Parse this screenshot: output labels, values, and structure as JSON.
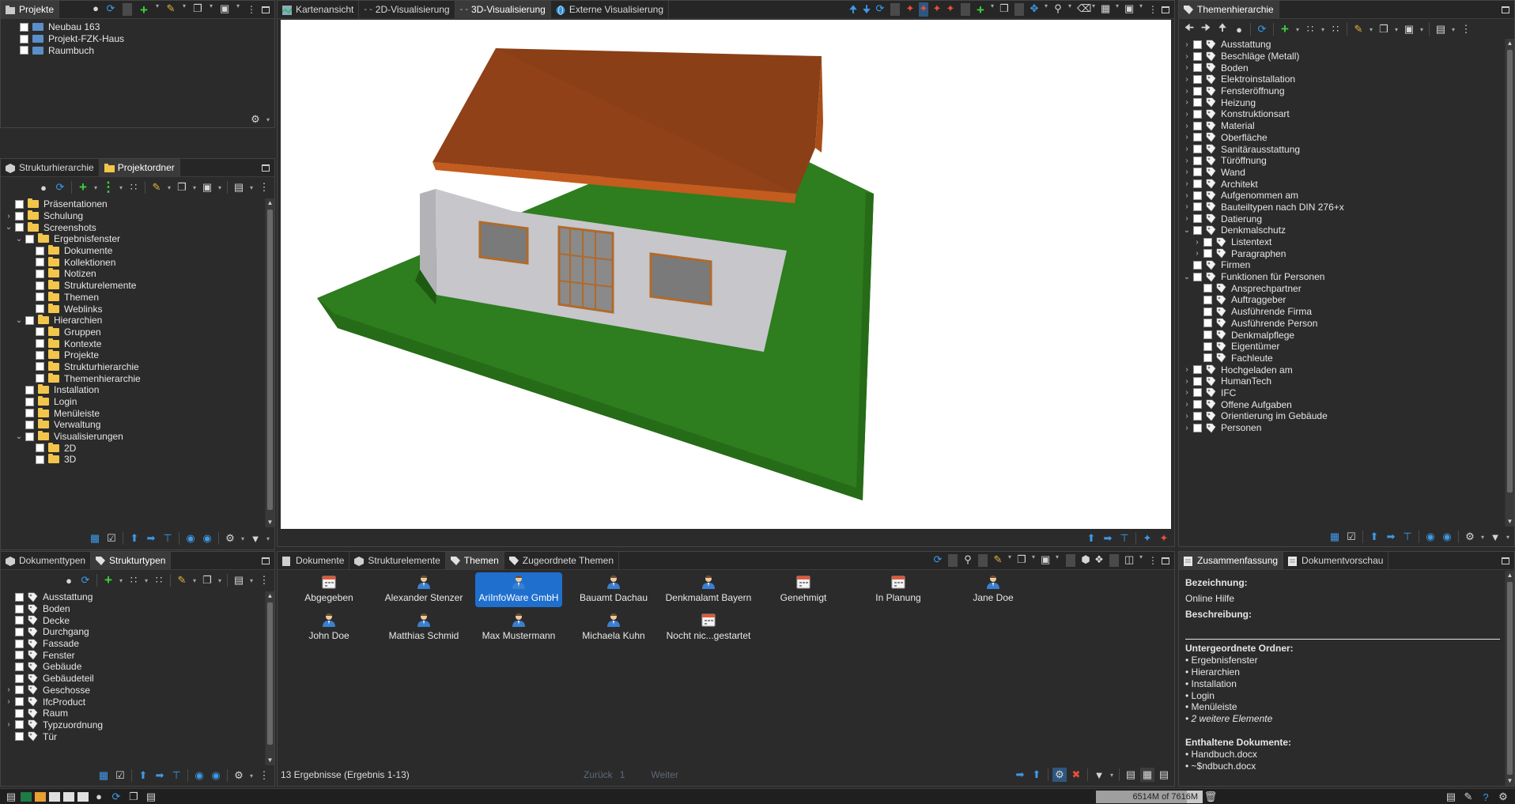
{
  "projects_panel": {
    "tab": "Projekte",
    "items": [
      "Neubau 163",
      "Projekt-FZK-Haus",
      "Raumbuch"
    ]
  },
  "folder_panel": {
    "tabs": [
      "Strukturhierarchie",
      "Projektordner"
    ],
    "items": [
      {
        "label": "Präsentationen",
        "level": 0,
        "twisty": ""
      },
      {
        "label": "Schulung",
        "level": 0,
        "twisty": ">"
      },
      {
        "label": "Screenshots",
        "level": 0,
        "twisty": "v"
      },
      {
        "label": "Ergebnisfenster",
        "level": 1,
        "twisty": "v"
      },
      {
        "label": "Dokumente",
        "level": 2,
        "twisty": ""
      },
      {
        "label": "Kollektionen",
        "level": 2,
        "twisty": ""
      },
      {
        "label": "Notizen",
        "level": 2,
        "twisty": ""
      },
      {
        "label": "Strukturelemente",
        "level": 2,
        "twisty": ""
      },
      {
        "label": "Themen",
        "level": 2,
        "twisty": ""
      },
      {
        "label": "Weblinks",
        "level": 2,
        "twisty": ""
      },
      {
        "label": "Hierarchien",
        "level": 1,
        "twisty": "v"
      },
      {
        "label": "Gruppen",
        "level": 2,
        "twisty": ""
      },
      {
        "label": "Kontexte",
        "level": 2,
        "twisty": ""
      },
      {
        "label": "Projekte",
        "level": 2,
        "twisty": ""
      },
      {
        "label": "Strukturhierarchie",
        "level": 2,
        "twisty": ""
      },
      {
        "label": "Themenhierarchie",
        "level": 2,
        "twisty": ""
      },
      {
        "label": "Installation",
        "level": 1,
        "twisty": ""
      },
      {
        "label": "Login",
        "level": 1,
        "twisty": ""
      },
      {
        "label": "Menüleiste",
        "level": 1,
        "twisty": ""
      },
      {
        "label": "Verwaltung",
        "level": 1,
        "twisty": ""
      },
      {
        "label": "Visualisierungen",
        "level": 1,
        "twisty": "v"
      },
      {
        "label": "2D",
        "level": 2,
        "twisty": ""
      },
      {
        "label": "3D",
        "level": 2,
        "twisty": ""
      }
    ]
  },
  "types_panel": {
    "tabs": [
      "Dokumenttypen",
      "Strukturtypen"
    ],
    "items": [
      {
        "label": "Ausstattung",
        "twisty": ""
      },
      {
        "label": "Boden",
        "twisty": ""
      },
      {
        "label": "Decke",
        "twisty": ""
      },
      {
        "label": "Durchgang",
        "twisty": ""
      },
      {
        "label": "Fassade",
        "twisty": ""
      },
      {
        "label": "Fenster",
        "twisty": ""
      },
      {
        "label": "Gebäude",
        "twisty": ""
      },
      {
        "label": "Gebäudeteil",
        "twisty": ""
      },
      {
        "label": "Geschosse",
        "twisty": ">"
      },
      {
        "label": "IfcProduct",
        "twisty": ">"
      },
      {
        "label": "Raum",
        "twisty": ""
      },
      {
        "label": "Typzuordnung",
        "twisty": ">"
      },
      {
        "label": "Tür",
        "twisty": ""
      }
    ]
  },
  "viewer": {
    "tabs": [
      "Kartenansicht",
      "2D-Visualisierung",
      "3D-Visualisierung",
      "Externe Visualisierung"
    ],
    "active_tab": 2
  },
  "results_panel": {
    "tabs": [
      "Dokumente",
      "Strukturelemente",
      "Themen",
      "Zugeordnete Themen"
    ],
    "items": [
      {
        "label": "Abgegeben",
        "icon": "calendar-icon",
        "selected": false
      },
      {
        "label": "Alexander Stenzer",
        "icon": "person-icon",
        "selected": false
      },
      {
        "label": "AriInfoWare GmbH",
        "icon": "person-icon",
        "selected": true
      },
      {
        "label": "Bauamt Dachau",
        "icon": "person-icon",
        "selected": false
      },
      {
        "label": "Denkmalamt Bayern",
        "icon": "person-icon",
        "selected": false
      },
      {
        "label": "Genehmigt",
        "icon": "calendar-icon",
        "selected": false
      },
      {
        "label": "In Planung",
        "icon": "calendar-icon",
        "selected": false
      },
      {
        "label": "Jane Doe",
        "icon": "person-icon",
        "selected": false
      },
      {
        "label": "John Doe",
        "icon": "person-icon",
        "selected": false
      },
      {
        "label": "Matthias Schmid",
        "icon": "person-icon",
        "selected": false
      },
      {
        "label": "Max Mustermann",
        "icon": "person-icon",
        "selected": false
      },
      {
        "label": "Michaela Kuhn",
        "icon": "person-icon",
        "selected": false
      },
      {
        "label": "Nocht nic...gestartet",
        "icon": "calendar-icon",
        "selected": false
      }
    ],
    "status_text": "13 Ergebnisse (Ergebnis 1-13)",
    "back_label": "Zurück",
    "page": "1",
    "next_label": "Weiter"
  },
  "topics_panel": {
    "tab": "Themenhierarchie",
    "items": [
      {
        "label": "Ausstattung",
        "level": 0,
        "twisty": ">"
      },
      {
        "label": "Beschläge (Metall)",
        "level": 0,
        "twisty": ">"
      },
      {
        "label": "Boden",
        "level": 0,
        "twisty": ">"
      },
      {
        "label": "Elektroinstallation",
        "level": 0,
        "twisty": ">"
      },
      {
        "label": "Fensteröffnung",
        "level": 0,
        "twisty": ">"
      },
      {
        "label": "Heizung",
        "level": 0,
        "twisty": ">"
      },
      {
        "label": "Konstruktionsart",
        "level": 0,
        "twisty": ">"
      },
      {
        "label": "Material",
        "level": 0,
        "twisty": ">"
      },
      {
        "label": "Oberfläche",
        "level": 0,
        "twisty": ">"
      },
      {
        "label": "Sanitärausstattung",
        "level": 0,
        "twisty": ">"
      },
      {
        "label": "Türöffnung",
        "level": 0,
        "twisty": ">"
      },
      {
        "label": "Wand",
        "level": 0,
        "twisty": ">"
      },
      {
        "label": "Architekt",
        "level": 0,
        "twisty": ">"
      },
      {
        "label": "Aufgenommen am",
        "level": 0,
        "twisty": ">"
      },
      {
        "label": "Bauteiltypen nach DIN 276+x",
        "level": 0,
        "twisty": ">"
      },
      {
        "label": "Datierung",
        "level": 0,
        "twisty": ">"
      },
      {
        "label": "Denkmalschutz",
        "level": 0,
        "twisty": "v"
      },
      {
        "label": "Listentext",
        "level": 1,
        "twisty": ">"
      },
      {
        "label": "Paragraphen",
        "level": 1,
        "twisty": ">"
      },
      {
        "label": "Firmen",
        "level": 0,
        "twisty": ""
      },
      {
        "label": "Funktionen für Personen",
        "level": 0,
        "twisty": "v"
      },
      {
        "label": "Ansprechpartner",
        "level": 1,
        "twisty": ""
      },
      {
        "label": "Auftraggeber",
        "level": 1,
        "twisty": ""
      },
      {
        "label": "Ausführende Firma",
        "level": 1,
        "twisty": ""
      },
      {
        "label": "Ausführende Person",
        "level": 1,
        "twisty": ""
      },
      {
        "label": "Denkmalpflege",
        "level": 1,
        "twisty": ""
      },
      {
        "label": "Eigentümer",
        "level": 1,
        "twisty": ""
      },
      {
        "label": "Fachleute",
        "level": 1,
        "twisty": ""
      },
      {
        "label": "Hochgeladen am",
        "level": 0,
        "twisty": ">"
      },
      {
        "label": "HumanTech",
        "level": 0,
        "twisty": ">"
      },
      {
        "label": "IFC",
        "level": 0,
        "twisty": ">"
      },
      {
        "label": "Offene Aufgaben",
        "level": 0,
        "twisty": ">"
      },
      {
        "label": "Orientierung im Gebäude",
        "level": 0,
        "twisty": ">"
      },
      {
        "label": "Personen",
        "level": 0,
        "twisty": ">"
      }
    ]
  },
  "summary_panel": {
    "tabs": [
      "Zusammenfassung",
      "Dokumentvorschau"
    ],
    "name_label": "Bezeichnung:",
    "name_value": "Online Hilfe",
    "desc_label": "Beschreibung:",
    "subfolders_label": "Untergeordnete Ordner:",
    "subfolders": [
      "• Ergebnisfenster",
      "• Hierarchien",
      "• Installation",
      "• Login",
      "• Menüleiste"
    ],
    "more_elements": "• 2 weitere Elemente",
    "docs_label": "Enthaltene Dokumente:",
    "docs": [
      "• Handbuch.docx",
      "• ~$ndbuch.docx"
    ]
  },
  "status_bar": {
    "memory": "6514M of 7616M",
    "memory_used_fraction": 0.855
  },
  "colors": {
    "roof": "#8a3f17",
    "wall": "#c6c6cb",
    "ground": "#2e7d1e",
    "selection": "#1f6fcf"
  }
}
